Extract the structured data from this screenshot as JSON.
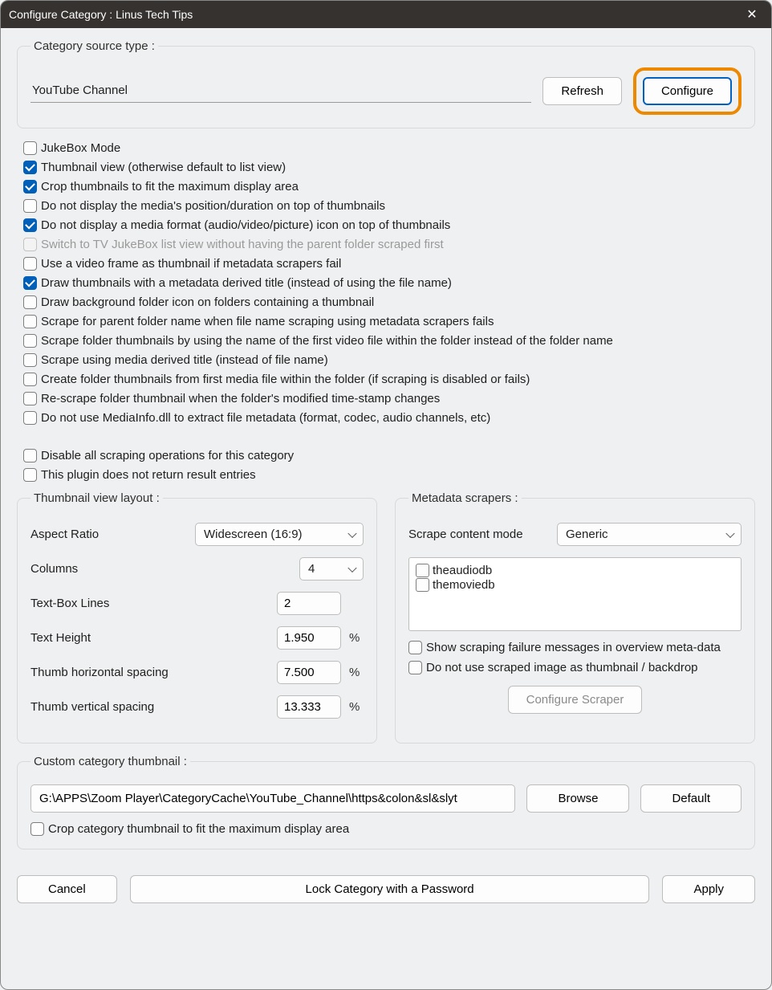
{
  "window": {
    "title": "Configure Category : Linus Tech Tips"
  },
  "source_section": {
    "legend": "Category source type :",
    "value": "YouTube Channel",
    "refresh_label": "Refresh",
    "configure_label": "Configure"
  },
  "options": [
    {
      "label": "JukeBox Mode",
      "checked": false,
      "disabled": false
    },
    {
      "label": "Thumbnail view (otherwise default to list view)",
      "checked": true,
      "disabled": false
    },
    {
      "label": "Crop thumbnails to fit the maximum display area",
      "checked": true,
      "disabled": false
    },
    {
      "label": "Do not display the media's position/duration on top of thumbnails",
      "checked": false,
      "disabled": false
    },
    {
      "label": "Do not display a media format (audio/video/picture) icon on top of thumbnails",
      "checked": true,
      "disabled": false
    },
    {
      "label": "Switch to TV JukeBox list view without having the parent folder scraped first",
      "checked": false,
      "disabled": true
    },
    {
      "label": "Use a video frame as thumbnail if metadata scrapers fail",
      "checked": false,
      "disabled": false
    },
    {
      "label": "Draw thumbnails with a metadata derived title (instead of using the file name)",
      "checked": true,
      "disabled": false
    },
    {
      "label": "Draw background folder icon on folders containing a thumbnail",
      "checked": false,
      "disabled": false
    },
    {
      "label": "Scrape for parent folder name when file name scraping using metadata scrapers fails",
      "checked": false,
      "disabled": false
    },
    {
      "label": "Scrape folder thumbnails by using the name of the first video file within the folder instead of the folder name",
      "checked": false,
      "disabled": false
    },
    {
      "label": "Scrape using media derived title (instead of file name)",
      "checked": false,
      "disabled": false
    },
    {
      "label": "Create folder thumbnails from first media file within the folder (if scraping is disabled or fails)",
      "checked": false,
      "disabled": false
    },
    {
      "label": "Re-scrape folder thumbnail when the folder's modified time-stamp changes",
      "checked": false,
      "disabled": false
    },
    {
      "label": "Do not use MediaInfo.dll to extract file metadata (format, codec, audio channels, etc)",
      "checked": false,
      "disabled": false
    }
  ],
  "options_group2": [
    {
      "label": "Disable all scraping operations for this category",
      "checked": false
    },
    {
      "label": "This plugin does not return result entries",
      "checked": false
    }
  ],
  "thumb_layout": {
    "legend": "Thumbnail view layout :",
    "aspect_label": "Aspect Ratio",
    "aspect_value": "Widescreen (16:9)",
    "columns_label": "Columns",
    "columns_value": "4",
    "textbox_lines_label": "Text-Box Lines",
    "textbox_lines_value": "2",
    "text_height_label": "Text Height",
    "text_height_value": "1.950",
    "hspacing_label": "Thumb horizontal spacing",
    "hspacing_value": "7.500",
    "vspacing_label": "Thumb vertical spacing",
    "vspacing_value": "13.333",
    "pct": "%"
  },
  "scrapers": {
    "legend": "Metadata scrapers :",
    "mode_label": "Scrape content mode",
    "mode_value": "Generic",
    "items": [
      {
        "label": "theaudiodb",
        "checked": false
      },
      {
        "label": "themoviedb",
        "checked": false
      }
    ],
    "show_fail_label": "Show scraping failure messages in overview meta-data",
    "no_thumb_label": "Do not use scraped image as thumbnail / backdrop",
    "configure_label": "Configure Scraper"
  },
  "custom_thumb": {
    "legend": "Custom category thumbnail :",
    "path": "G:\\APPS\\Zoom Player\\CategoryCache\\YouTube_Channel\\https&colon&sl&slyt",
    "browse_label": "Browse",
    "default_label": "Default",
    "crop_label": "Crop category thumbnail to fit the maximum display area"
  },
  "footer": {
    "cancel": "Cancel",
    "lock": "Lock Category with a Password",
    "apply": "Apply"
  }
}
